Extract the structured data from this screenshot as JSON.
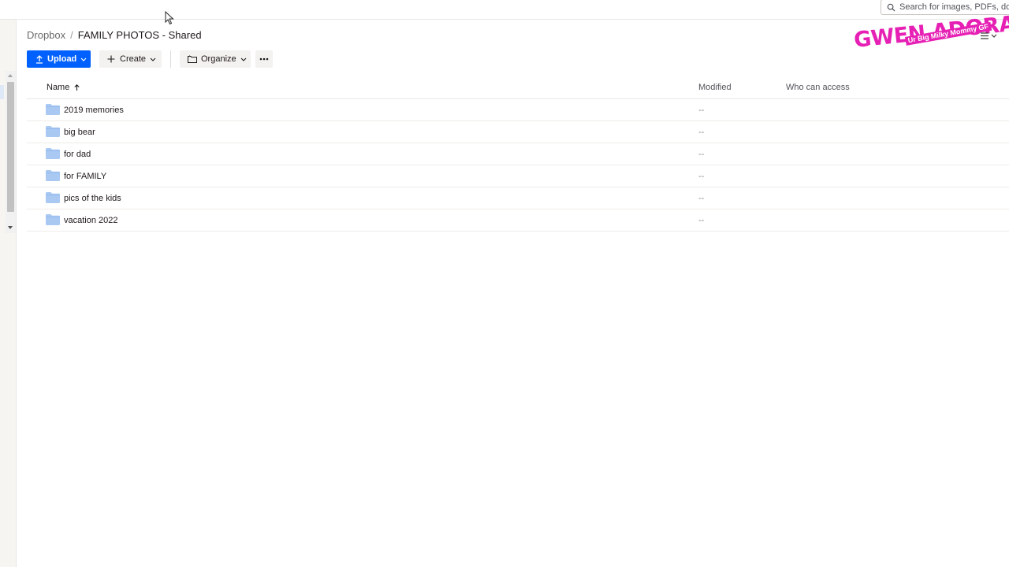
{
  "search": {
    "placeholder": "Search for images, PDFs, documents"
  },
  "breadcrumb": {
    "root": "Dropbox",
    "separator": "/",
    "current": "FAMILY PHOTOS - Shared"
  },
  "toolbar": {
    "upload_label": "Upload",
    "create_label": "Create",
    "organize_label": "Organize"
  },
  "logo": {
    "title": "GWEN ADORA",
    "subtitle": "Ur Big Milky Mommy GF",
    "color": "#e620b4"
  },
  "table": {
    "columns": {
      "name": "Name",
      "modified": "Modified",
      "access": "Who can access"
    },
    "sort": {
      "column": "Name",
      "direction": "ascending"
    },
    "rows": [
      {
        "name": "2019 memories",
        "modified": "--",
        "icon": "folder-icon"
      },
      {
        "name": "big bear",
        "modified": "--",
        "icon": "folder-icon"
      },
      {
        "name": "for dad",
        "modified": "--",
        "icon": "folder-icon"
      },
      {
        "name": "for FAMILY",
        "modified": "--",
        "icon": "folder-icon"
      },
      {
        "name": "pics of the kids",
        "modified": "--",
        "icon": "folder-icon"
      },
      {
        "name": "vacation 2022",
        "modified": "--",
        "icon": "folder-icon"
      }
    ]
  },
  "colors": {
    "primary": "#0061fe",
    "folder": "#a9c9f3",
    "text": "#1e1919"
  }
}
